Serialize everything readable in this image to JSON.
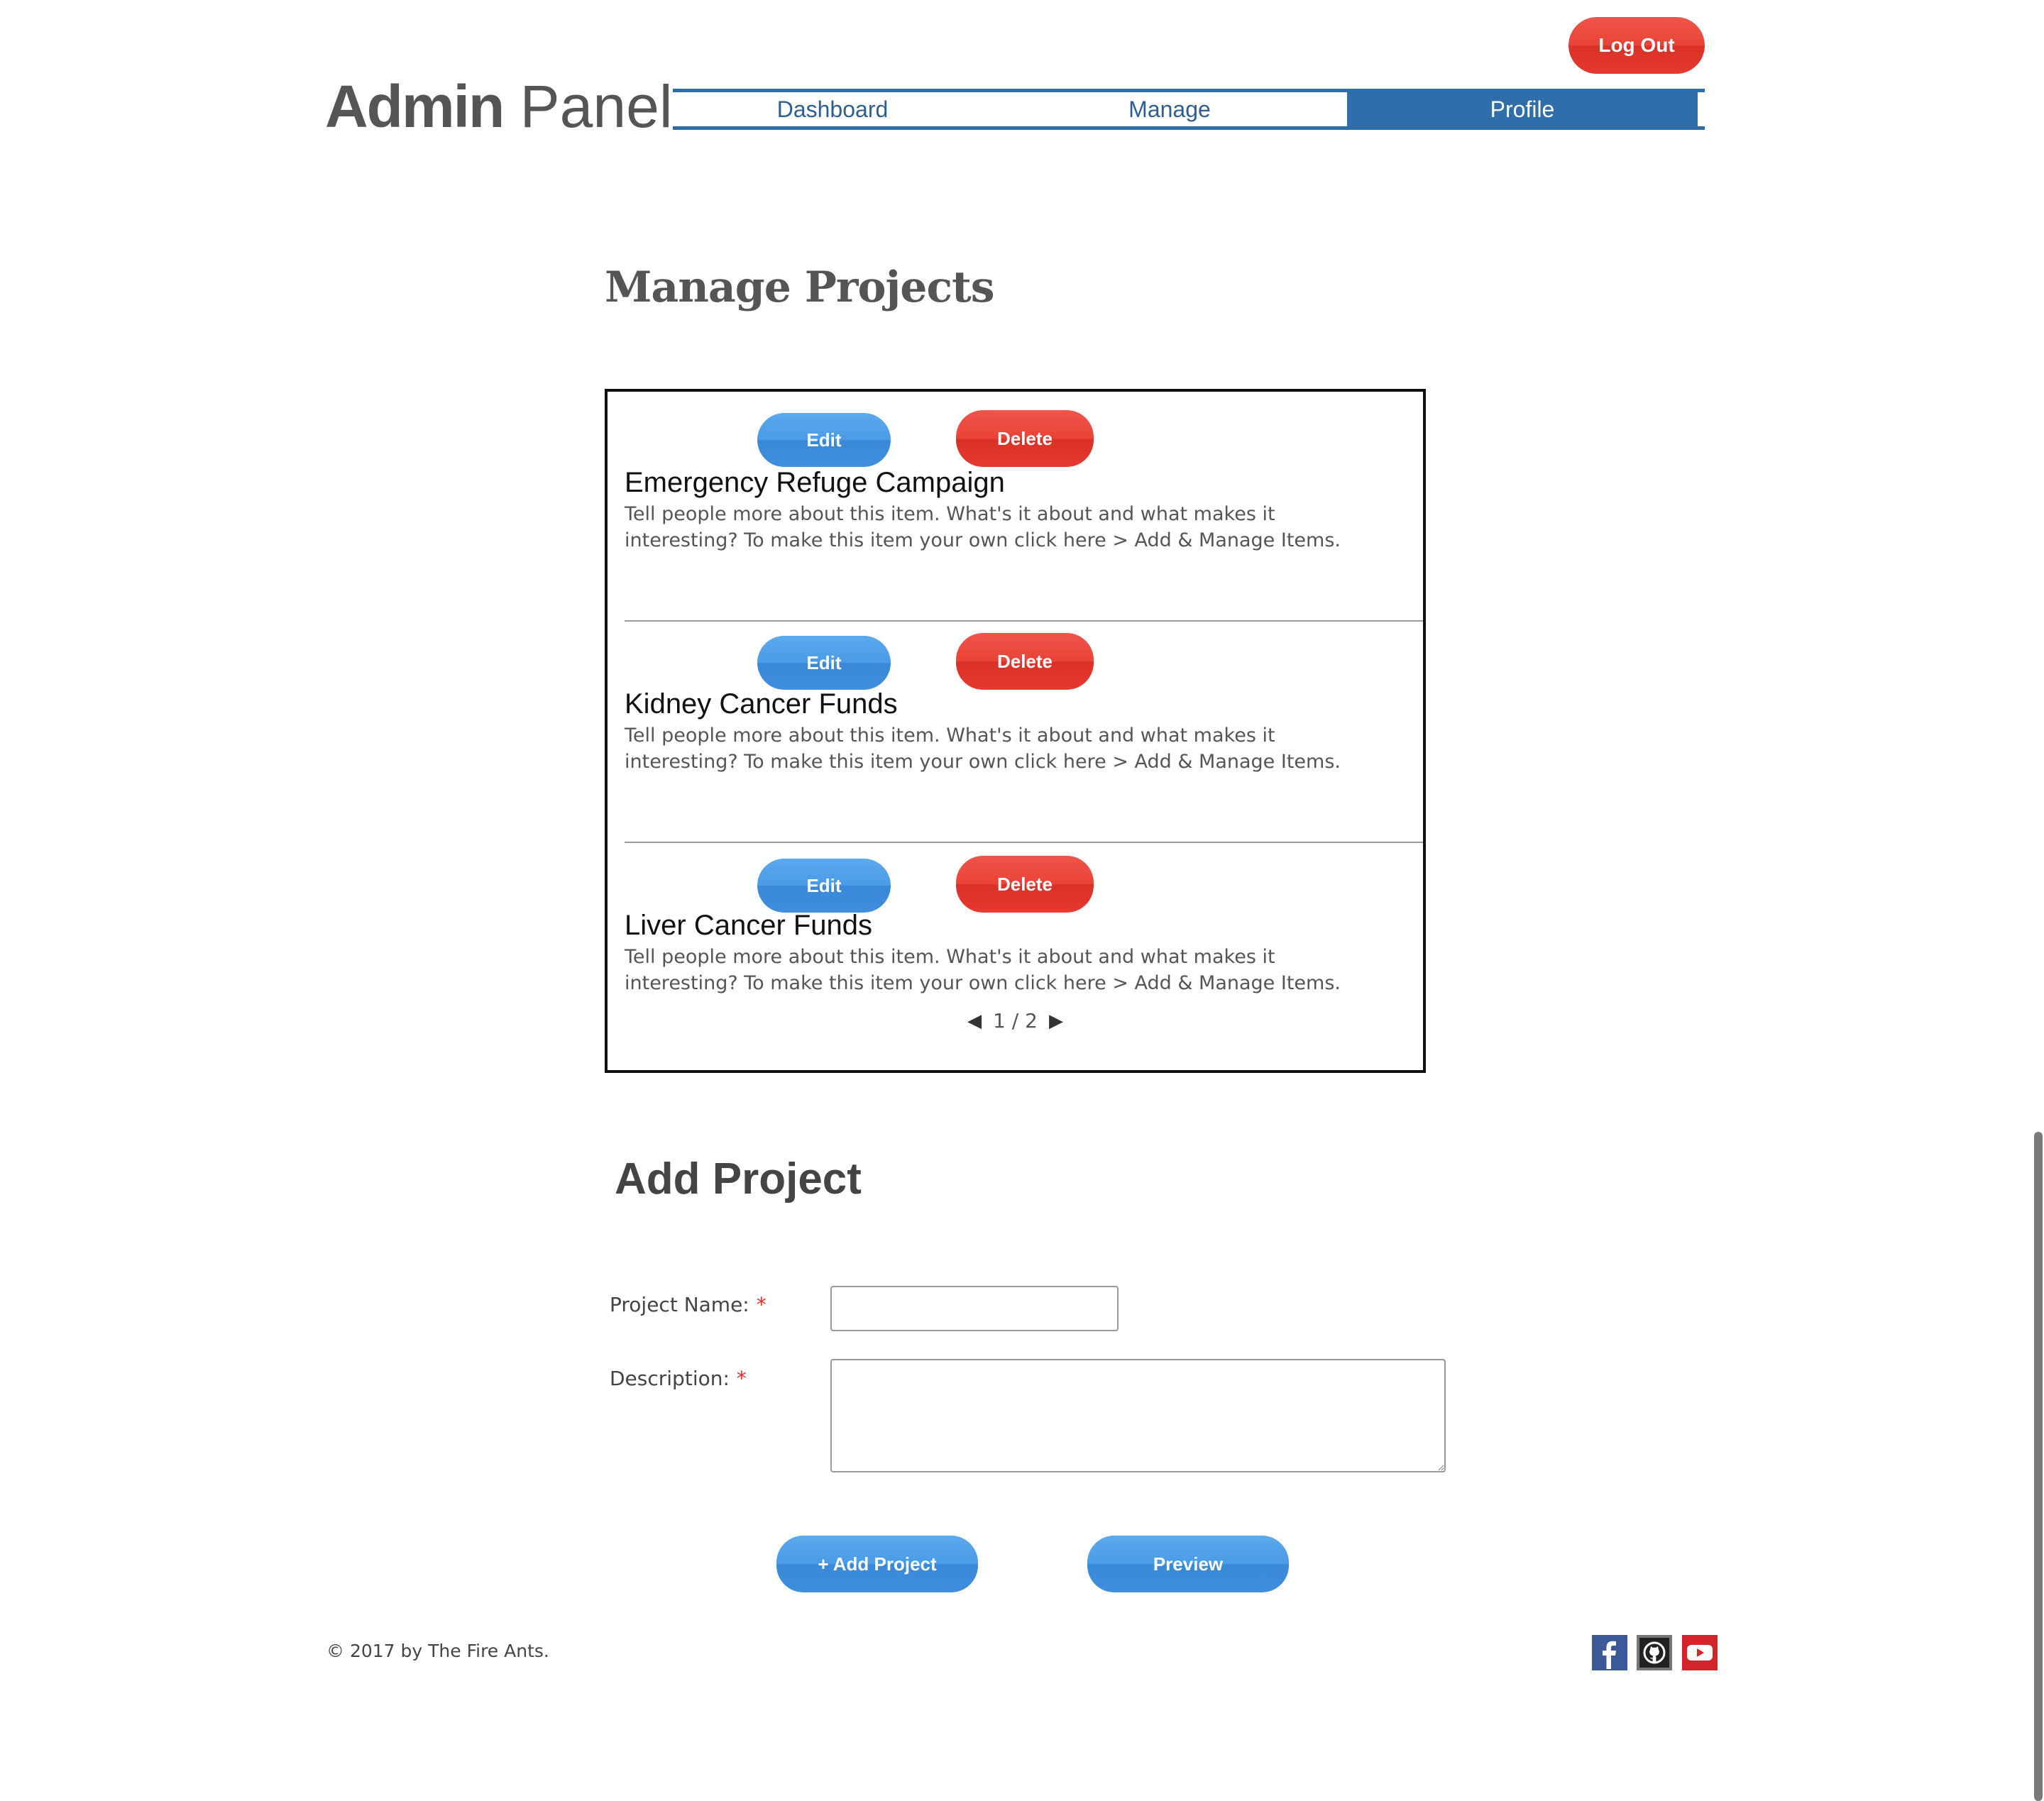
{
  "header": {
    "logout_label": "Log Out",
    "brand_bold": "Admin",
    "brand_light": "Panel",
    "nav": [
      {
        "label": "Dashboard",
        "active": false
      },
      {
        "label": "Manage",
        "active": false
      },
      {
        "label": "Profile",
        "active": true
      }
    ]
  },
  "manage": {
    "title": "Manage Projects",
    "edit_label": "Edit",
    "delete_label": "Delete",
    "items": [
      {
        "title": "Emergency Refuge Campaign",
        "description": "Tell people more about this item. What's it about and what makes it interesting? To make this item your own click here > Add & Manage Items."
      },
      {
        "title": "Kidney Cancer Funds",
        "description": "Tell people more about this item. What's it about and what makes it interesting? To make this item your own click here > Add & Manage Items."
      },
      {
        "title": "Liver Cancer Funds",
        "description": "Tell people more about this item. What's it about and what makes it interesting? To make this item your own click here > Add & Manage Items."
      }
    ],
    "pager": {
      "prev_icon": "◀",
      "next_icon": "▶",
      "text": "1 / 2"
    }
  },
  "add_project": {
    "title": "Add Project",
    "name_label": "Project Name:",
    "description_label": "Description:",
    "required_mark": "*",
    "name_value": "",
    "description_value": "",
    "add_button": "+ Add Project",
    "preview_button": "Preview"
  },
  "footer": {
    "copyright": "© 2017 by The Fire Ants.",
    "social": [
      "facebook-icon",
      "github-icon",
      "youtube-icon"
    ]
  },
  "colors": {
    "nav_accent": "#2f6ea8",
    "button_blue": "#4a9be6",
    "button_red": "#ea4337"
  }
}
